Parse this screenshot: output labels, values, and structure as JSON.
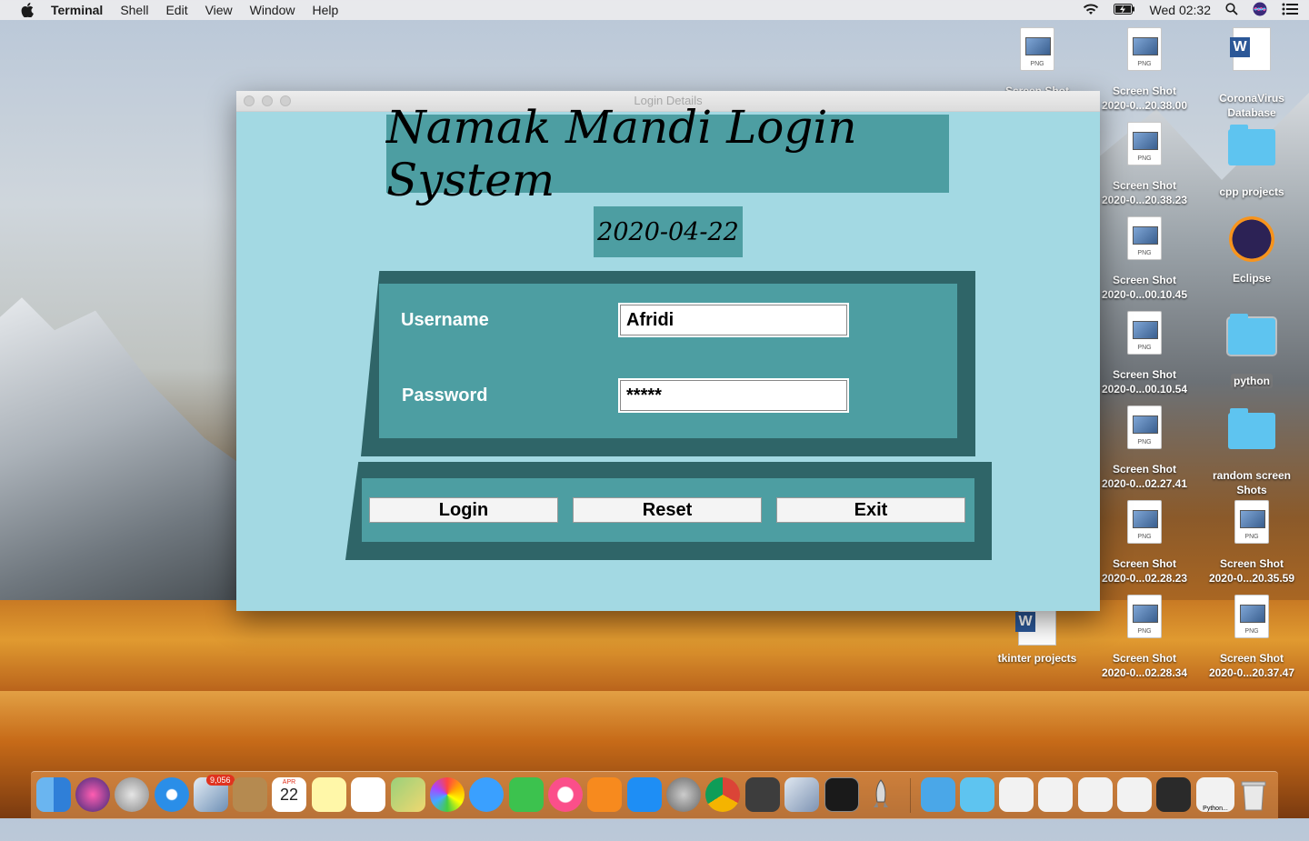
{
  "menubar": {
    "app": "Terminal",
    "items": [
      "Shell",
      "Edit",
      "View",
      "Window",
      "Help"
    ],
    "clock": "Wed 02:32"
  },
  "desktop_icons": [
    {
      "label1": "Screen Shot",
      "label2": "",
      "icon": "png-file-icon"
    },
    {
      "label1": "Screen Shot",
      "label2": "2020-0...20.38.00",
      "icon": "png-file-icon"
    },
    {
      "label1": "CoronaVirus",
      "label2": "Database",
      "icon": "word-document-icon"
    },
    {
      "label1": "Screen Shot",
      "label2": "2020-0...20.38.23",
      "icon": "png-file-icon"
    },
    {
      "label1": "cpp projects",
      "label2": "",
      "icon": "folder-icon"
    },
    {
      "label1": "Screen Shot",
      "label2": "2020-0...00.10.45",
      "icon": "png-file-icon"
    },
    {
      "label1": "Eclipse",
      "label2": "",
      "icon": "eclipse-app-icon"
    },
    {
      "label1": "Screen Shot",
      "label2": "2020-0...00.10.54",
      "icon": "png-file-icon"
    },
    {
      "label1": "python",
      "label2": "",
      "icon": "folder-icon"
    },
    {
      "label1": "Screen Shot",
      "label2": "2020-0...02.27.41",
      "icon": "png-file-icon"
    },
    {
      "label1": "random screen",
      "label2": "Shots",
      "icon": "folder-icon"
    },
    {
      "label1": "Screen Shot",
      "label2": "2020-0...02.28.23",
      "icon": "png-file-icon"
    },
    {
      "label1": "Screen Shot",
      "label2": "2020-0...20.35.59",
      "icon": "png-file-icon"
    },
    {
      "label1": "tkinter projects",
      "label2": "",
      "icon": "word-document-icon"
    },
    {
      "label1": "Screen Shot",
      "label2": "2020-0...02.28.34",
      "icon": "png-file-icon"
    },
    {
      "label1": "Screen Shot",
      "label2": "2020-0...20.37.47",
      "icon": "png-file-icon"
    }
  ],
  "png_tag": "PNG",
  "window": {
    "title": "Login Details",
    "banner": "Namak Mandi Login System",
    "date": "2020-04-22",
    "username_label": "Username",
    "username_value": "Afridi",
    "password_label": "Password",
    "password_value": "*****",
    "buttons": {
      "login": "Login",
      "reset": "Reset",
      "exit": "Exit"
    }
  },
  "dock": {
    "mail_badge": "9,056",
    "calendar_month": "APR",
    "calendar_day": "22",
    "python_label": "Python..."
  }
}
